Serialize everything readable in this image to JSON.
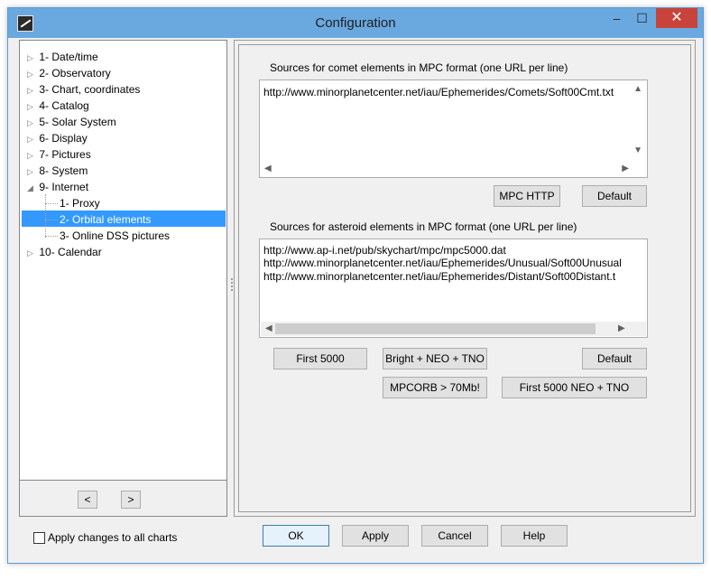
{
  "window": {
    "title": "Configuration",
    "minimize": "–",
    "maximize": "☐",
    "close": "✕"
  },
  "tree": {
    "items": [
      {
        "label": "1- Date/time"
      },
      {
        "label": "2- Observatory"
      },
      {
        "label": "3- Chart, coordinates"
      },
      {
        "label": "4- Catalog"
      },
      {
        "label": "5- Solar System"
      },
      {
        "label": "6- Display"
      },
      {
        "label": "7- Pictures"
      },
      {
        "label": "8- System"
      },
      {
        "label": "9- Internet"
      },
      {
        "label": "1- Proxy"
      },
      {
        "label": "2- Orbital elements"
      },
      {
        "label": "3- Online DSS pictures"
      },
      {
        "label": "10- Calendar"
      }
    ],
    "prev": "<",
    "next": ">"
  },
  "comet": {
    "label": "Sources for comet elements in MPC format (one URL per line)",
    "lines": [
      "http://www.minorplanetcenter.net/iau/Ephemerides/Comets/Soft00Cmt.txt"
    ],
    "btn_mpc": "MPC HTTP",
    "btn_default": "Default"
  },
  "asteroid": {
    "label": "Sources for asteroid elements in MPC format (one URL per line)",
    "lines": [
      "http://www.ap-i.net/pub/skychart/mpc/mpc5000.dat",
      "http://www.minorplanetcenter.net/iau/Ephemerides/Unusual/Soft00Unusual",
      "http://www.minorplanetcenter.net/iau/Ephemerides/Distant/Soft00Distant.t"
    ],
    "btn_first5000": "First 5000",
    "btn_bright": "Bright + NEO + TNO",
    "btn_default": "Default",
    "btn_mpcorb": "MPCORB > 70Mb!",
    "btn_first5000neo": "First 5000 NEO + TNO"
  },
  "footer": {
    "apply_all": "Apply changes to all charts",
    "ok": "OK",
    "apply": "Apply",
    "cancel": "Cancel",
    "help": "Help"
  }
}
